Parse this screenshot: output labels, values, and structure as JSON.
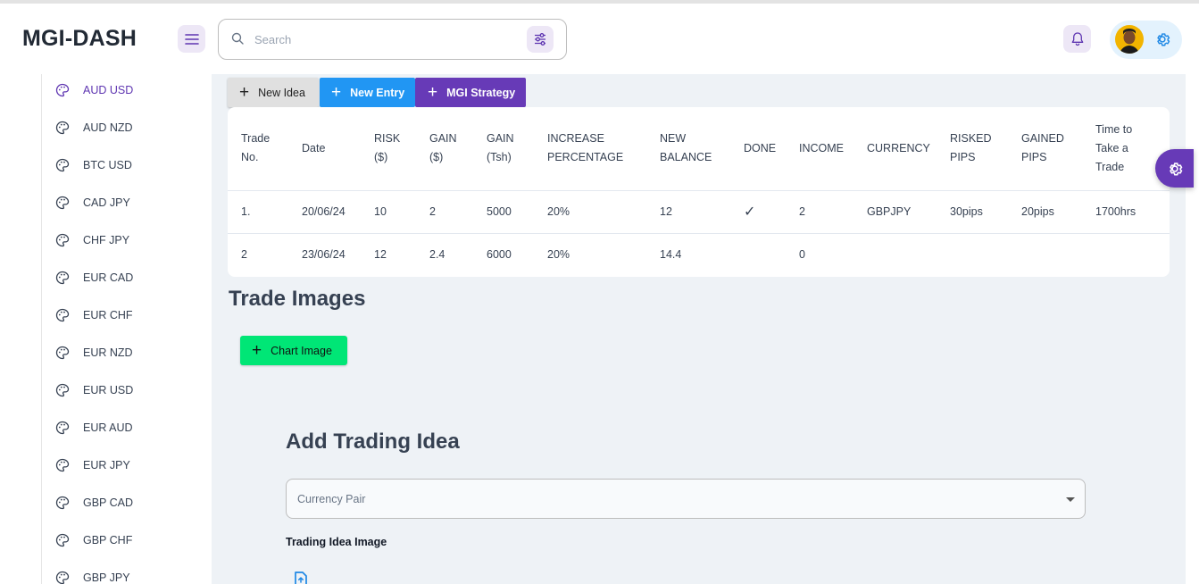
{
  "app": {
    "brand": "MGI-DASH"
  },
  "search": {
    "placeholder": "Search"
  },
  "sidebar": {
    "items": [
      {
        "label": "AUD USD",
        "active": true
      },
      {
        "label": "AUD NZD"
      },
      {
        "label": "BTC USD"
      },
      {
        "label": "CAD JPY"
      },
      {
        "label": "CHF JPY"
      },
      {
        "label": "EUR CAD"
      },
      {
        "label": "EUR CHF"
      },
      {
        "label": "EUR NZD"
      },
      {
        "label": "EUR USD"
      },
      {
        "label": "EUR AUD"
      },
      {
        "label": "EUR JPY"
      },
      {
        "label": "GBP CAD"
      },
      {
        "label": "GBP CHF"
      },
      {
        "label": "GBP JPY"
      }
    ]
  },
  "toolbar": {
    "new_idea": "New Idea",
    "new_entry": "New Entry",
    "mgi_strategy": "MGI Strategy"
  },
  "table": {
    "headers": [
      [
        "Trade",
        "No."
      ],
      [
        "Date"
      ],
      [
        "RISK",
        "($)"
      ],
      [
        "GAIN",
        "($)"
      ],
      [
        "GAIN",
        "(Tsh)"
      ],
      [
        "INCREASE",
        "PERCENTAGE"
      ],
      [
        "NEW",
        "BALANCE"
      ],
      [
        "DONE"
      ],
      [
        "INCOME"
      ],
      [
        "CURRENCY"
      ],
      [
        "RISKED",
        "PIPS"
      ],
      [
        "GAINED",
        "PIPS"
      ],
      [
        "Time to",
        "Take a",
        "Trade"
      ]
    ],
    "rows": [
      [
        "1.",
        "20/06/24",
        "10",
        "2",
        "5000",
        "20%",
        "12",
        "✓",
        "2",
        "GBPJPY",
        "30pips",
        "20pips",
        "1700hrs"
      ],
      [
        "2",
        "23/06/24",
        "12",
        "2.4",
        "6000",
        "20%",
        "14.4",
        "",
        "0",
        "",
        "",
        "",
        ""
      ]
    ]
  },
  "trade_images": {
    "title": "Trade Images",
    "chart_button": "Chart Image"
  },
  "form": {
    "title": "Add Trading Idea",
    "currency_placeholder": "Currency Pair",
    "image_label": "Trading Idea Image"
  },
  "colors": {
    "accent_purple": "#673ab7",
    "accent_blue": "#2196f3",
    "accent_green": "#00e676",
    "active_nav": "#5e35b1"
  }
}
